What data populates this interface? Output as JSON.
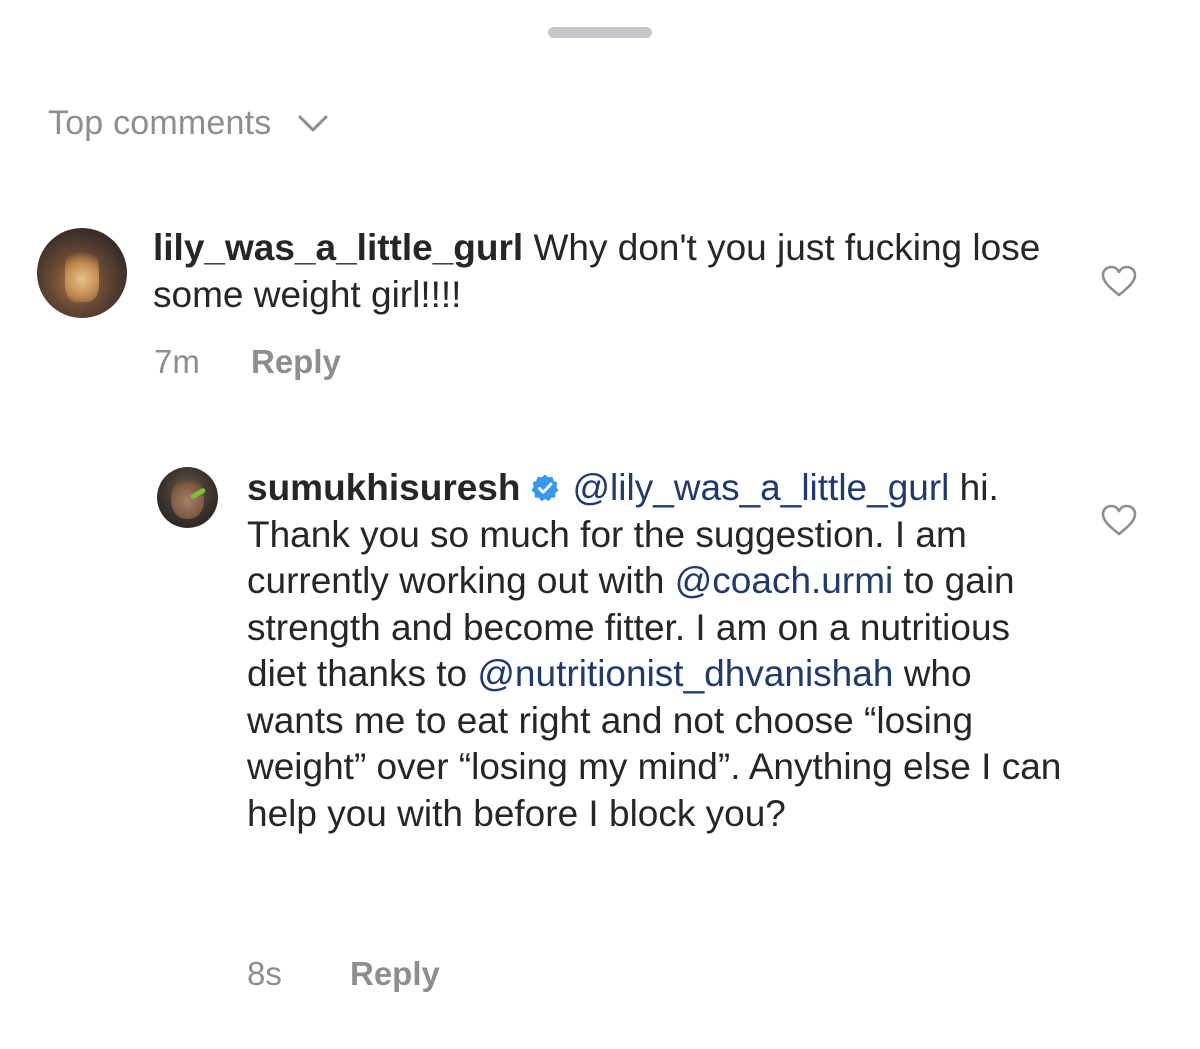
{
  "header": {
    "sort_label": "Top comments"
  },
  "comments": [
    {
      "username": "lily_was_a_little_gurl",
      "text": " Why don't you just fucking lose some weight girl!!!!",
      "timestamp": "7m",
      "reply_label": "Reply"
    }
  ],
  "replies": [
    {
      "username": "sumukhisuresh",
      "verified": true,
      "segments": [
        {
          "type": "mention",
          "text": "@lily_was_a_little_gurl"
        },
        {
          "type": "text",
          "text": " hi. Thank you so much for the suggestion. I am currently working out with "
        },
        {
          "type": "mention",
          "text": "@coach.urmi"
        },
        {
          "type": "text",
          "text": " to gain strength and become fitter. I am on a nutritious diet thanks to "
        },
        {
          "type": "mention",
          "text": "@nutritionist_dhvanishah"
        },
        {
          "type": "text",
          "text": " who wants me to eat right and not choose “losing weight” over “losing my mind”. Anything else I can help you with before I block you?"
        }
      ],
      "timestamp": "8s",
      "reply_label": "Reply"
    }
  ],
  "colors": {
    "text": "#262626",
    "secondary": "#8e8e8e",
    "mention": "#1f3a6b",
    "verified": "#3897f0"
  },
  "icons": {
    "sort": "chevron-down-icon",
    "like": "heart-outline-icon",
    "verified": "verified-badge-icon"
  }
}
